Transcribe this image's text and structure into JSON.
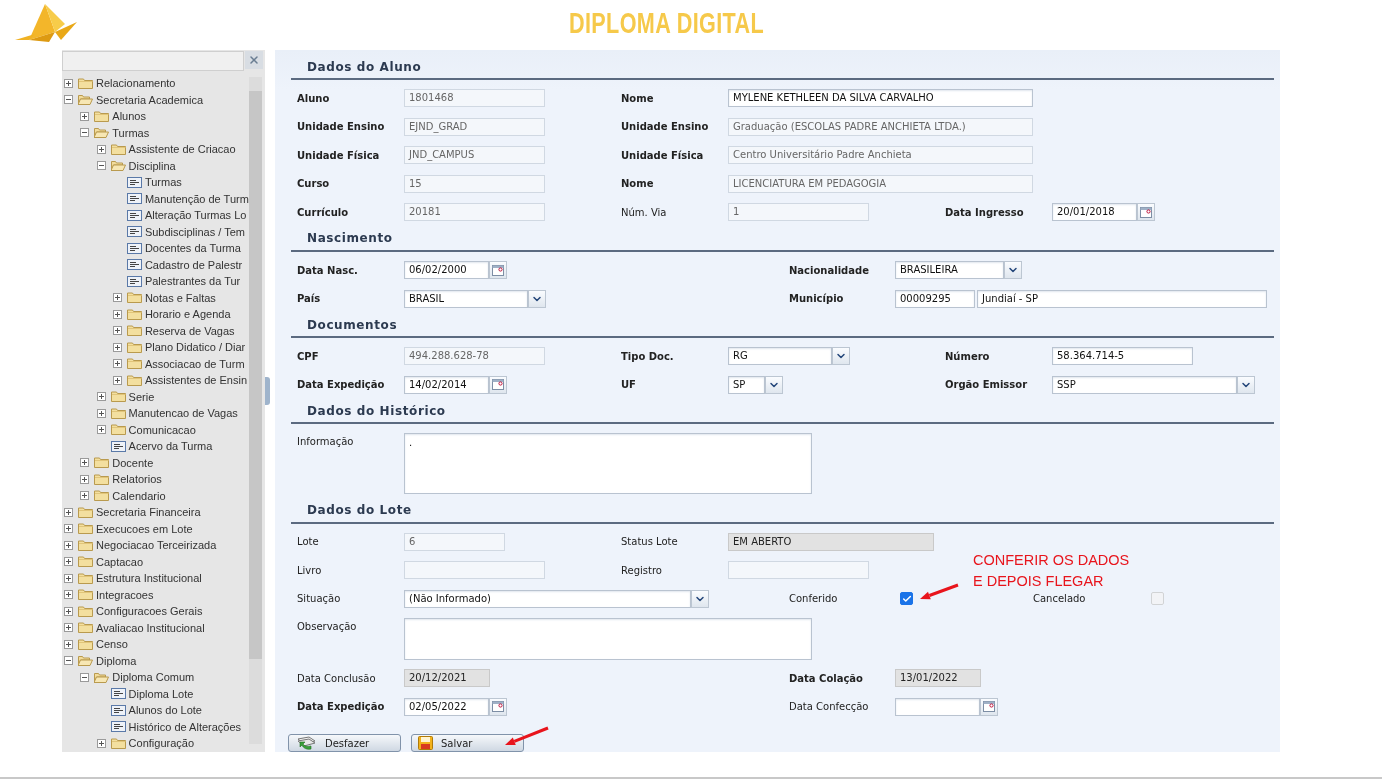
{
  "header": {
    "title": "DIPLOMA DIGITAL"
  },
  "sidebar": {
    "tree": [
      {
        "label": "Relacionamento",
        "kind": "folder",
        "expanded": false
      },
      {
        "label": "Secretaria Academica",
        "kind": "folder",
        "expanded": true,
        "children": [
          {
            "label": "Alunos",
            "kind": "folder",
            "expanded": false
          },
          {
            "label": "Turmas",
            "kind": "folder",
            "expanded": true,
            "children": [
              {
                "label": "Assistente de Criacao",
                "kind": "folder",
                "expanded": false
              },
              {
                "label": "Disciplina",
                "kind": "folder",
                "expanded": true,
                "children": [
                  {
                    "label": "Turmas",
                    "kind": "page"
                  },
                  {
                    "label": "Manutenção de Turm",
                    "kind": "page"
                  },
                  {
                    "label": "Alteração Turmas Lo",
                    "kind": "page"
                  },
                  {
                    "label": "Subdisciplinas / Tem",
                    "kind": "page"
                  },
                  {
                    "label": "Docentes da Turma",
                    "kind": "page"
                  },
                  {
                    "label": "Cadastro de Palestr",
                    "kind": "page"
                  },
                  {
                    "label": "Palestrantes da Tur",
                    "kind": "page"
                  },
                  {
                    "label": "Notas e Faltas",
                    "kind": "folder",
                    "expanded": false
                  },
                  {
                    "label": "Horario e Agenda",
                    "kind": "folder",
                    "expanded": false
                  },
                  {
                    "label": "Reserva de Vagas",
                    "kind": "folder",
                    "expanded": false
                  },
                  {
                    "label": "Plano Didatico / Diar",
                    "kind": "folder",
                    "expanded": false
                  },
                  {
                    "label": "Associacao de Turm",
                    "kind": "folder",
                    "expanded": false
                  },
                  {
                    "label": "Assistentes de Ensin",
                    "kind": "folder",
                    "expanded": false
                  }
                ]
              },
              {
                "label": "Serie",
                "kind": "folder",
                "expanded": false
              },
              {
                "label": "Manutencao de Vagas",
                "kind": "folder",
                "expanded": false
              },
              {
                "label": "Comunicacao",
                "kind": "folder",
                "expanded": false
              },
              {
                "label": "Acervo da Turma",
                "kind": "page"
              }
            ]
          },
          {
            "label": "Docente",
            "kind": "folder",
            "expanded": false
          },
          {
            "label": "Relatorios",
            "kind": "folder",
            "expanded": false
          },
          {
            "label": "Calendario",
            "kind": "folder",
            "expanded": false
          }
        ]
      },
      {
        "label": "Secretaria Financeira",
        "kind": "folder",
        "expanded": false
      },
      {
        "label": "Execucoes em Lote",
        "kind": "folder",
        "expanded": false
      },
      {
        "label": "Negociacao Terceirizada",
        "kind": "folder",
        "expanded": false
      },
      {
        "label": "Captacao",
        "kind": "folder",
        "expanded": false
      },
      {
        "label": "Estrutura Institucional",
        "kind": "folder",
        "expanded": false
      },
      {
        "label": "Integracoes",
        "kind": "folder",
        "expanded": false
      },
      {
        "label": "Configuracoes Gerais",
        "kind": "folder",
        "expanded": false
      },
      {
        "label": "Avaliacao Institucional",
        "kind": "folder",
        "expanded": false
      },
      {
        "label": "Censo",
        "kind": "folder",
        "expanded": false
      },
      {
        "label": "Diploma",
        "kind": "folder",
        "expanded": true,
        "children": [
          {
            "label": "Diploma Comum",
            "kind": "folder",
            "expanded": true,
            "children": [
              {
                "label": "Diploma Lote",
                "kind": "page"
              },
              {
                "label": "Alunos do Lote",
                "kind": "page"
              },
              {
                "label": "Histórico de Alterações",
                "kind": "page"
              },
              {
                "label": "Configuração",
                "kind": "folder",
                "expanded": false
              }
            ]
          }
        ]
      }
    ]
  },
  "sections": [
    {
      "title": "Dados do Aluno",
      "fields": [
        {
          "label": "Aluno",
          "bold": true,
          "kind": "text",
          "value": "1801468",
          "readonly": true,
          "disabled": false
        },
        {
          "label": "Nome",
          "bold": true,
          "kind": "text",
          "value": "MYLENE KETHLEEN DA SILVA CARVALHO",
          "readonly": false,
          "disabled": false
        },
        {
          "label": "Unidade Ensino",
          "bold": true,
          "kind": "text",
          "value": "EJND_GRAD",
          "readonly": true,
          "disabled": false
        },
        {
          "label": "Unidade Ensino",
          "bold": true,
          "kind": "text",
          "value": "Graduação (ESCOLAS PADRE ANCHIETA LTDA.)",
          "readonly": true,
          "disabled": false
        },
        {
          "label": "Unidade Física",
          "bold": true,
          "kind": "text",
          "value": "JND_CAMPUS",
          "readonly": true,
          "disabled": false
        },
        {
          "label": "Unidade Física",
          "bold": true,
          "kind": "text",
          "value": "Centro Universitário Padre Anchieta",
          "readonly": true,
          "disabled": false
        },
        {
          "label": "Curso",
          "bold": true,
          "kind": "text",
          "value": "15",
          "readonly": true,
          "disabled": false
        },
        {
          "label": "Nome",
          "bold": true,
          "kind": "text",
          "value": "LICENCIATURA EM PEDAGOGIA",
          "readonly": true,
          "disabled": false
        },
        {
          "label": "Currículo",
          "bold": true,
          "kind": "text",
          "value": "20181",
          "readonly": true,
          "disabled": false
        },
        {
          "label": "Núm. Via",
          "bold": false,
          "kind": "text",
          "value": "1",
          "readonly": true,
          "disabled": false
        },
        {
          "label": "Data Ingresso",
          "bold": true,
          "kind": "date",
          "value": "20/01/2018",
          "readonly": false,
          "disabled": false
        }
      ]
    },
    {
      "title": "Nascimento",
      "fields": [
        {
          "label": "Data Nasc.",
          "bold": true,
          "kind": "date",
          "value": "06/02/2000",
          "readonly": false,
          "disabled": false
        },
        {
          "label": "Nacionalidade",
          "bold": true,
          "kind": "select",
          "value": "BRASILEIRA",
          "readonly": false,
          "disabled": false
        },
        {
          "label": "País",
          "bold": true,
          "kind": "select",
          "value": "BRASIL",
          "readonly": false,
          "disabled": false
        },
        {
          "label": "Município",
          "bold": true,
          "kind": "lookup",
          "code": "00009295",
          "value": "Jundiaí - SP",
          "readonly": false,
          "disabled": false
        }
      ]
    },
    {
      "title": "Documentos",
      "fields": [
        {
          "label": "CPF",
          "bold": true,
          "kind": "text",
          "value": "494.288.628-78",
          "readonly": true,
          "disabled": false
        },
        {
          "label": "Tipo Doc.",
          "bold": true,
          "kind": "select",
          "value": "RG",
          "readonly": false,
          "disabled": false
        },
        {
          "label": "Número",
          "bold": true,
          "kind": "text",
          "value": "58.364.714-5",
          "readonly": false,
          "disabled": false
        },
        {
          "label": "Data Expedição",
          "bold": true,
          "kind": "date",
          "value": "14/02/2014",
          "readonly": false,
          "disabled": false
        },
        {
          "label": "UF",
          "bold": true,
          "kind": "select",
          "value": "SP",
          "readonly": false,
          "disabled": false
        },
        {
          "label": "Orgão Emissor",
          "bold": true,
          "kind": "select",
          "value": "SSP",
          "readonly": false,
          "disabled": false
        }
      ]
    },
    {
      "title": "Dados do Histórico",
      "fields": [
        {
          "label": "Informação",
          "bold": false,
          "kind": "textarea",
          "value": ".",
          "readonly": false,
          "disabled": false
        }
      ]
    },
    {
      "title": "Dados do Lote",
      "fields": [
        {
          "label": "Lote",
          "bold": false,
          "kind": "text",
          "value": "6",
          "readonly": true,
          "disabled": false
        },
        {
          "label": "Status Lote",
          "bold": false,
          "kind": "text",
          "value": "EM ABERTO",
          "readonly": false,
          "disabled": true
        },
        {
          "label": "Livro",
          "bold": false,
          "kind": "text",
          "readonly": true,
          "disabled": false
        },
        {
          "label": "Registro",
          "bold": false,
          "kind": "text",
          "readonly": true,
          "disabled": false
        },
        {
          "label": "Situação",
          "bold": false,
          "kind": "select",
          "value": "(Não Informado)",
          "readonly": false,
          "disabled": false
        },
        {
          "label": "Conferido",
          "bold": false,
          "kind": "checkbox",
          "checked": true,
          "disabled": false
        },
        {
          "label": "Cancelado",
          "bold": false,
          "kind": "checkbox",
          "checked": false,
          "disabled": true
        },
        {
          "label": "Observação",
          "bold": false,
          "kind": "textarea",
          "readonly": false,
          "disabled": false
        },
        {
          "label": "Data Conclusão",
          "bold": false,
          "kind": "text",
          "value": "20/12/2021",
          "readonly": false,
          "disabled": true
        },
        {
          "label": "Data Colação",
          "bold": true,
          "kind": "text",
          "value": "13/01/2022",
          "readonly": false,
          "disabled": true
        },
        {
          "label": "Data Expedição",
          "bold": true,
          "kind": "date",
          "value": "02/05/2022",
          "readonly": false,
          "disabled": false
        },
        {
          "label": "Data Confecção",
          "bold": false,
          "kind": "date",
          "readonly": false,
          "disabled": false
        }
      ]
    }
  ],
  "buttons": [
    {
      "label": "Desfazer",
      "kind": "undo"
    },
    {
      "label": "Salvar",
      "kind": "save"
    }
  ],
  "annotation": {
    "lines": [
      "CONFERIR OS DADOS",
      "E DEPOIS FLEGAR"
    ]
  }
}
